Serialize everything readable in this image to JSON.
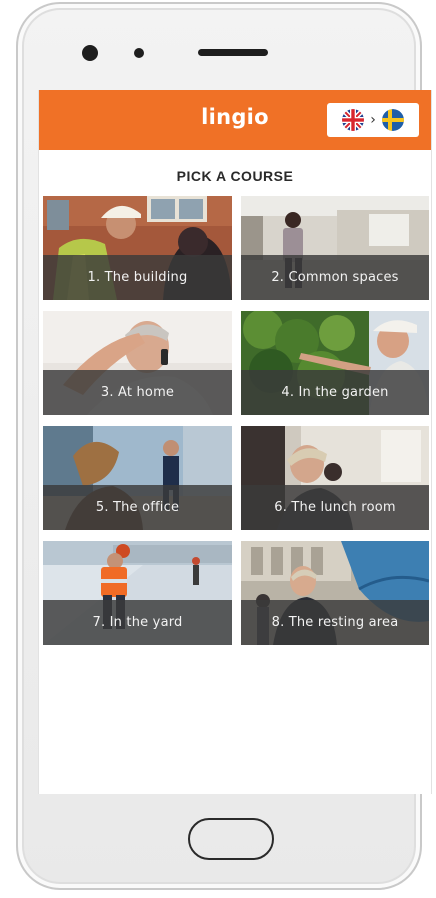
{
  "app": {
    "logo_text": "lingio",
    "lang_from_icon": "uk-flag-icon",
    "lang_arrow": "›",
    "lang_to_icon": "sweden-flag-icon"
  },
  "colors": {
    "brand_orange": "#f07126",
    "tile_overlay": "#3a3a3a",
    "title_text": "#2a2a2a"
  },
  "main": {
    "title": "PICK A COURSE",
    "courses": [
      {
        "label": "1. The building",
        "icon": "building-worker-photo"
      },
      {
        "label": "2. Common spaces",
        "icon": "common-spaces-photo"
      },
      {
        "label": "3. At home",
        "icon": "at-home-photo"
      },
      {
        "label": "4. In the garden",
        "icon": "garden-photo"
      },
      {
        "label": "5. The office",
        "icon": "office-photo"
      },
      {
        "label": "6. The lunch room",
        "icon": "lunch-room-photo"
      },
      {
        "label": "7. In the yard",
        "icon": "yard-photo"
      },
      {
        "label": "8. The resting area",
        "icon": "resting-area-photo"
      }
    ]
  }
}
